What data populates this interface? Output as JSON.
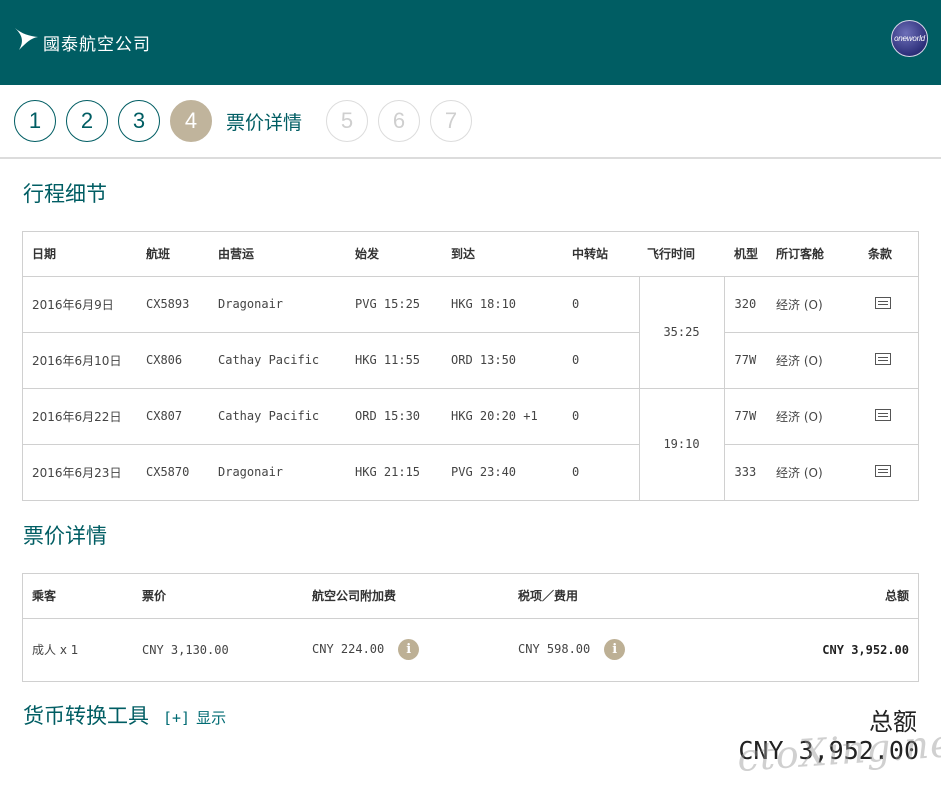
{
  "header": {
    "logo_text": "國泰航空公司",
    "alliance_badge": "oneworld"
  },
  "steps": {
    "items": [
      "1",
      "2",
      "3",
      "4",
      "5",
      "6",
      "7"
    ],
    "active_index": 3,
    "active_label": "票价详情"
  },
  "itinerary": {
    "title": "行程细节",
    "columns": [
      "日期",
      "航班",
      "由营运",
      "始发",
      "到达",
      "中转站",
      "飞行时间",
      "机型",
      "所订客舱",
      "条款"
    ],
    "rows": [
      {
        "date": "2016年6月9日",
        "flight": "CX5893",
        "operator": "Dragonair",
        "depart": "PVG 15:25",
        "arrive": "HKG 18:10",
        "stops": "0",
        "aircraft": "320",
        "cabin": "经济 (O)"
      },
      {
        "date": "2016年6月10日",
        "flight": "CX806",
        "operator": "Cathay Pacific",
        "depart": "HKG 11:55",
        "arrive": "ORD 13:50",
        "stops": "0",
        "aircraft": "77W",
        "cabin": "经济 (O)"
      },
      {
        "date": "2016年6月22日",
        "flight": "CX807",
        "operator": "Cathay Pacific",
        "depart": "ORD 15:30",
        "arrive": "HKG 20:20 +1",
        "stops": "0",
        "aircraft": "77W",
        "cabin": "经济 (O)"
      },
      {
        "date": "2016年6月23日",
        "flight": "CX5870",
        "operator": "Dragonair",
        "depart": "HKG 21:15",
        "arrive": "PVG 23:40",
        "stops": "0",
        "aircraft": "333",
        "cabin": "经济 (O)"
      }
    ],
    "durations": [
      "35:25",
      "19:10"
    ]
  },
  "fare": {
    "title": "票价详情",
    "columns": [
      "乘客",
      "票价",
      "航空公司附加费",
      "税项／费用",
      "总额"
    ],
    "row": {
      "passenger": "成人 x 1",
      "fare": "CNY 3,130.00",
      "surcharge": "CNY 224.00",
      "taxes": "CNY 598.00",
      "total": "CNY 3,952.00",
      "info_glyph": "i"
    }
  },
  "converter": {
    "title": "货币转换工具",
    "toggle": "[+]",
    "toggle_label": "显示"
  },
  "summary": {
    "total_label": "总额",
    "total_value": "CNY 3,952.00"
  },
  "watermark": "ctoXing.net",
  "colors": {
    "brand": "#005d63",
    "active_step": "#c0b49c",
    "info_icon": "#bdb095"
  }
}
